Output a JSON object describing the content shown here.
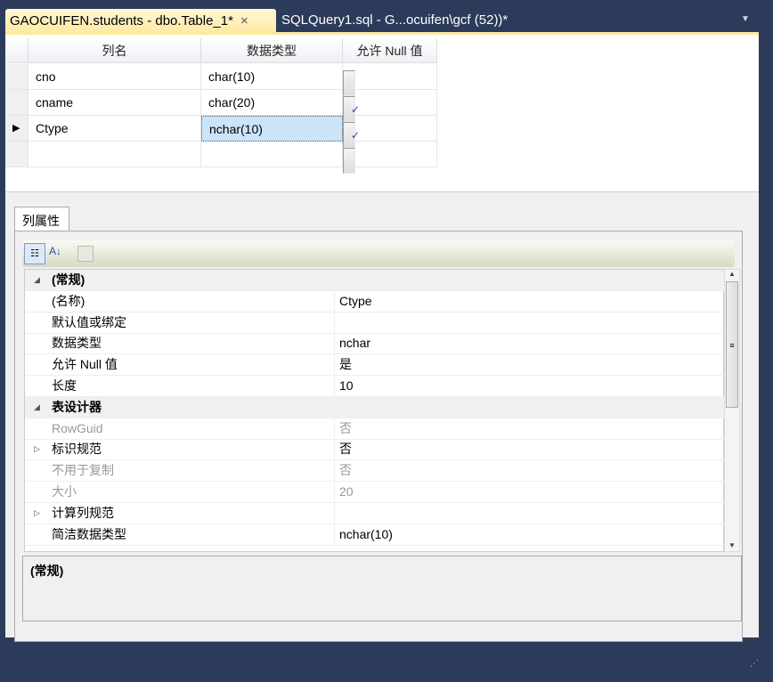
{
  "tabs": [
    {
      "label": "GAOCUIFEN.students - dbo.Table_1*",
      "close": "×"
    },
    {
      "label": "SQLQuery1.sql - G...ocuifen\\gcf (52))*"
    }
  ],
  "overflow": "▼",
  "grid": {
    "headers": [
      "列名",
      "数据类型",
      "允许 Null 值"
    ],
    "rows": [
      {
        "name": "cno",
        "type": "char(10)",
        "null": false,
        "current": false
      },
      {
        "name": "cname",
        "type": "char(20)",
        "null": true,
        "current": false
      },
      {
        "name": "Ctype",
        "type": "nchar(10)",
        "null": true,
        "current": true
      },
      {
        "name": "",
        "type": "",
        "null": false,
        "current": false
      }
    ]
  },
  "props": {
    "tab": "列属性",
    "rows": [
      {
        "cat": true,
        "name": "(常规)"
      },
      {
        "name": "(名称)",
        "value": "Ctype"
      },
      {
        "name": "默认值或绑定",
        "value": ""
      },
      {
        "name": "数据类型",
        "value": "nchar"
      },
      {
        "name": "允许 Null 值",
        "value": "是"
      },
      {
        "name": "长度",
        "value": "10"
      },
      {
        "cat": true,
        "name": "表设计器"
      },
      {
        "name": "RowGuid",
        "value": "否",
        "gray": true
      },
      {
        "name": "标识规范",
        "value": "否",
        "expand": true
      },
      {
        "name": "不用于复制",
        "value": "否",
        "gray": true
      },
      {
        "name": "大小",
        "value": "20",
        "gray": true
      },
      {
        "name": "计算列规范",
        "value": "",
        "expand": true
      },
      {
        "name": "简洁数据类型",
        "value": "nchar(10)"
      }
    ],
    "description": "(常规)"
  }
}
